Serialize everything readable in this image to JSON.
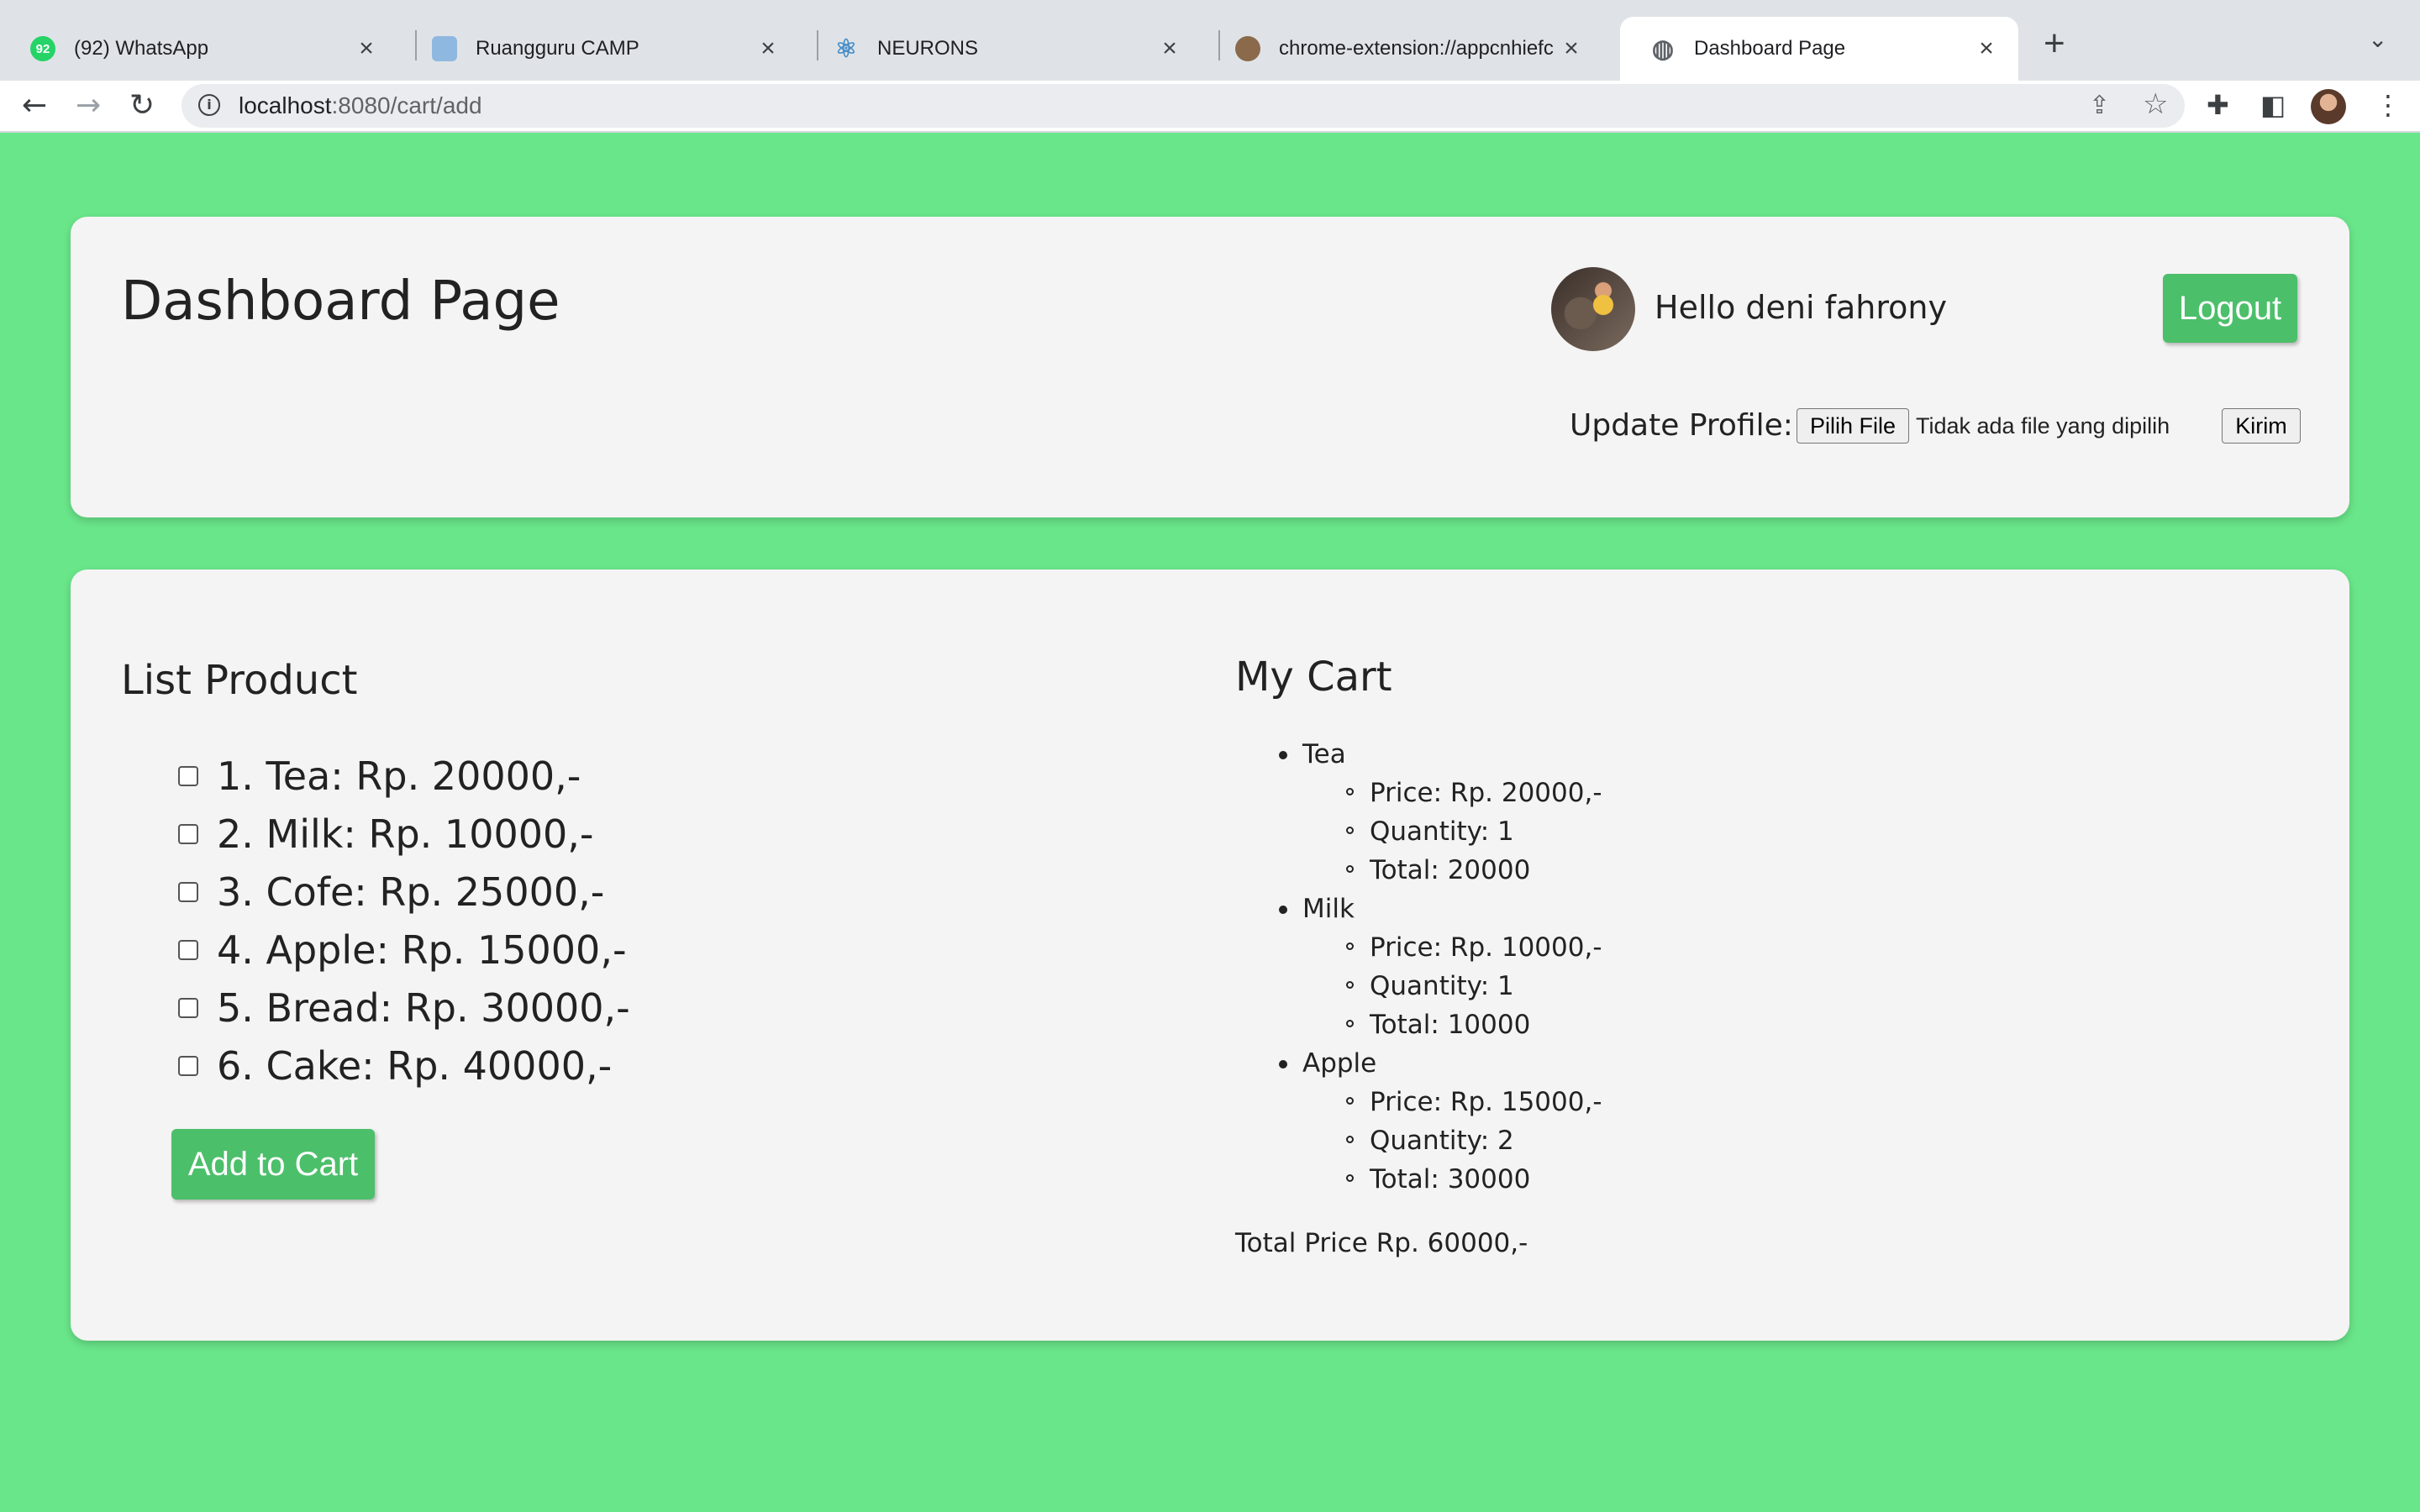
{
  "browser": {
    "tabs": [
      {
        "title": "(92) WhatsApp",
        "icon": "whatsapp-icon",
        "badge": "92"
      },
      {
        "title": "Ruangguru CAMP",
        "icon": "ruangguru-icon"
      },
      {
        "title": "NEURONS",
        "icon": "react-icon"
      },
      {
        "title": "chrome-extension://appcnhiefc",
        "icon": "owl-icon"
      },
      {
        "title": "Dashboard Page",
        "icon": "globe-icon"
      }
    ],
    "active_tab": 4,
    "url_host": "localhost",
    "url_path": ":8080/cart/add"
  },
  "header": {
    "title": "Dashboard Page",
    "greeting": "Hello deni fahrony",
    "logout_label": "Logout",
    "update_label": "Update Profile:",
    "file_button_label": "Pilih File",
    "file_status": "Tidak ada file yang dipilih",
    "submit_label": "Kirim"
  },
  "products": {
    "title": "List Product",
    "items": [
      {
        "label": "1. Tea: Rp. 20000,-",
        "checked": false
      },
      {
        "label": "2. Milk: Rp. 10000,-",
        "checked": false
      },
      {
        "label": "3. Cofe: Rp. 25000,-",
        "checked": false
      },
      {
        "label": "4. Apple: Rp. 15000,-",
        "checked": false
      },
      {
        "label": "5. Bread: Rp. 30000,-",
        "checked": false
      },
      {
        "label": "6. Cake: Rp. 40000,-",
        "checked": false
      }
    ],
    "add_label": "Add to Cart"
  },
  "cart": {
    "title": "My Cart",
    "items": [
      {
        "name": "Tea",
        "price": "Price: Rp. 20000,-",
        "quantity": "Quantity: 1",
        "total": "Total: 20000"
      },
      {
        "name": "Milk",
        "price": "Price: Rp. 10000,-",
        "quantity": "Quantity: 1",
        "total": "Total: 10000"
      },
      {
        "name": "Apple",
        "price": "Price: Rp. 15000,-",
        "quantity": "Quantity: 2",
        "total": "Total: 30000"
      }
    ],
    "total_price": "Total Price Rp. 60000,-"
  },
  "colors": {
    "page_background": "#6ae68a",
    "card_background": "#f4f4f4",
    "button_green": "#4cbf6a"
  }
}
